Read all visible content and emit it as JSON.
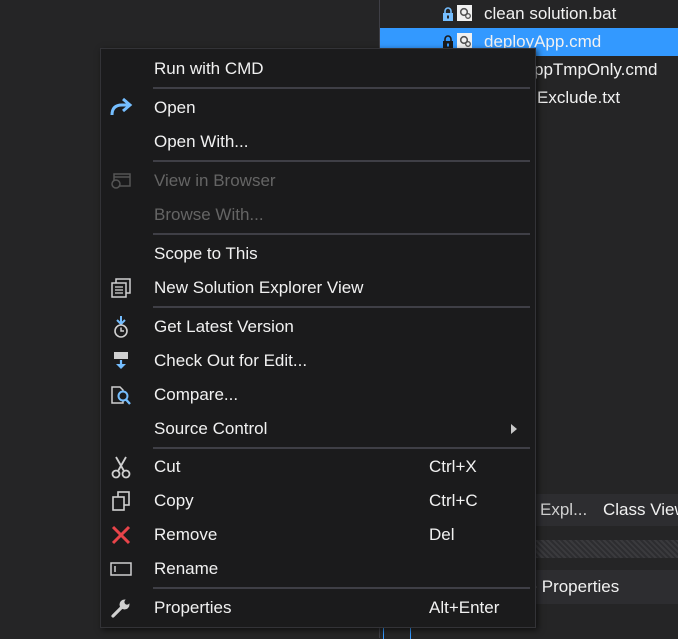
{
  "solution_explorer": {
    "files": [
      {
        "name": "clean solution.bat",
        "selected": false
      },
      {
        "name": "deployApp.cmd",
        "selected": true
      },
      {
        "name": "rAppTmpOnly.cmd",
        "selected": false
      },
      {
        "name": "Exclude.txt",
        "selected": false
      }
    ],
    "tabs": [
      "Expl...",
      "Class View"
    ],
    "properties_header": "ile Properties"
  },
  "context_menu": {
    "groups": [
      [
        {
          "label": "Run with CMD",
          "icon": "none",
          "enabled": true
        }
      ],
      [
        {
          "label": "Open",
          "icon": "open-arrow-icon",
          "enabled": true
        },
        {
          "label": "Open With...",
          "icon": "none",
          "enabled": true
        }
      ],
      [
        {
          "label": "View in Browser",
          "icon": "view-in-browser-icon",
          "enabled": false
        },
        {
          "label": "Browse With...",
          "icon": "none",
          "enabled": false
        }
      ],
      [
        {
          "label": "Scope to This",
          "icon": "none",
          "enabled": true
        },
        {
          "label": "New Solution Explorer View",
          "icon": "new-explorer-view-icon",
          "enabled": true
        }
      ],
      [
        {
          "label": "Get Latest Version",
          "icon": "get-latest-icon",
          "enabled": true
        },
        {
          "label": "Check Out for Edit...",
          "icon": "check-out-icon",
          "enabled": true
        },
        {
          "label": "Compare...",
          "icon": "compare-icon",
          "enabled": true
        },
        {
          "label": "Source Control",
          "icon": "none",
          "enabled": true,
          "submenu": true
        }
      ],
      [
        {
          "label": "Cut",
          "icon": "scissors-icon",
          "shortcut": "Ctrl+X",
          "enabled": true
        },
        {
          "label": "Copy",
          "icon": "copy-icon",
          "shortcut": "Ctrl+C",
          "enabled": true
        },
        {
          "label": "Remove",
          "icon": "remove-x-icon",
          "shortcut": "Del",
          "enabled": true
        },
        {
          "label": "Rename",
          "icon": "rename-icon",
          "enabled": true
        }
      ],
      [
        {
          "label": "Properties",
          "icon": "wrench-icon",
          "shortcut": "Alt+Enter",
          "enabled": true
        }
      ]
    ]
  },
  "colors": {
    "background": "#252526",
    "menu_background": "#1b1b1c",
    "selection": "#3399ff",
    "text": "#f1f1f1",
    "disabled_text": "#656565",
    "icon_blue": "#75beff",
    "remove_red": "#e8444a"
  }
}
